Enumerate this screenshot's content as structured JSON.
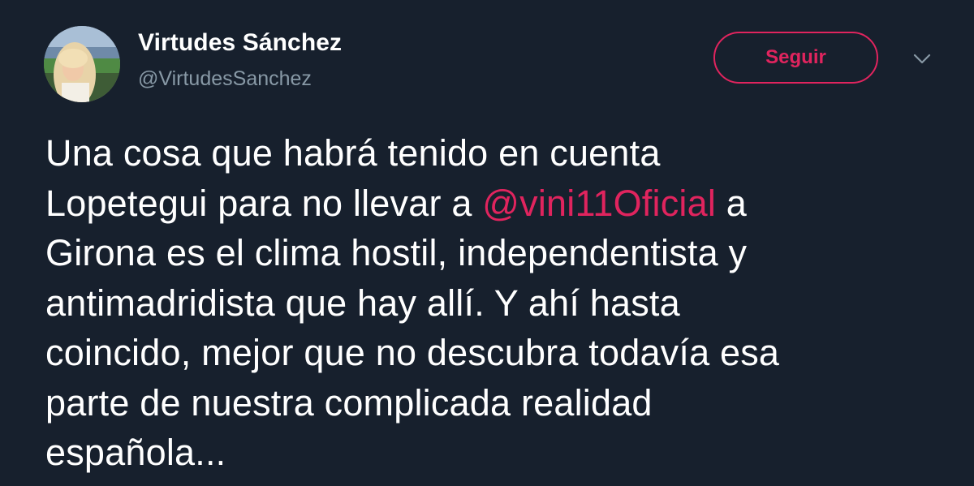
{
  "author": {
    "name": "Virtudes Sánchez",
    "handle": "@VirtudesSanchez"
  },
  "follow_button": {
    "label": "Seguir"
  },
  "icons": {
    "more": "chevron-down-icon"
  },
  "tweet": {
    "lines": [
      "Una cosa que habrá tenido en cuenta",
      "Lopetegui para no llevar a ",
      "Girona es el clima hostil, independentista y",
      "antimadridista que hay allí. Y ahí hasta",
      "coincido, mejor que no descubra todavía esa",
      "parte de nuestra complicada realidad",
      "española..."
    ],
    "mention": "@vini11Oficial",
    "after_mention": " a"
  },
  "colors": {
    "background": "#17202d",
    "accent": "#e0245e",
    "secondary_text": "#8899a6"
  }
}
